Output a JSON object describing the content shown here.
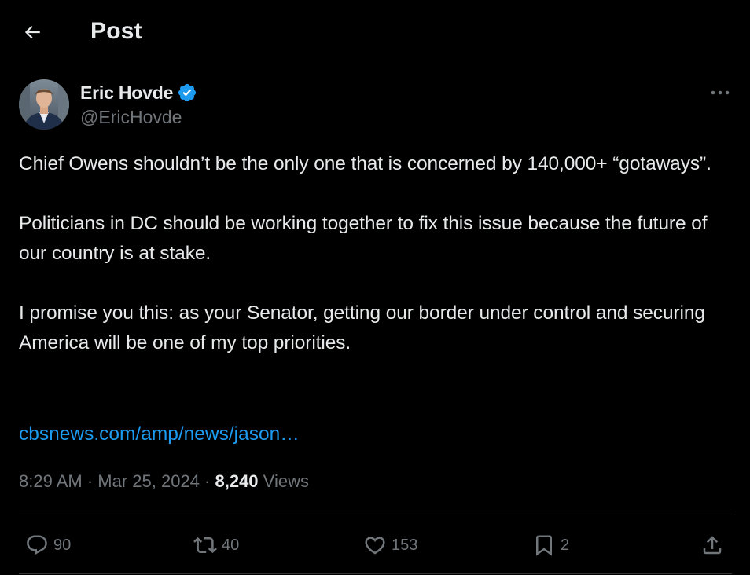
{
  "header": {
    "title": "Post",
    "back_icon": "arrow-left-icon"
  },
  "author": {
    "display_name": "Eric Hovde",
    "handle": "@EricHovde",
    "verified": true,
    "verified_icon": "verified-badge-icon",
    "avatar_icon": "avatar-photo"
  },
  "post": {
    "paragraphs": [
      "Chief Owens shouldn’t be the only one that is concerned by 140,000+ “gotaways”.",
      "Politicians in DC should be working together to fix this issue because the future of our country is at stake.",
      "I promise you this: as your Senator, getting our border under control and securing America will be one of my top priorities."
    ],
    "link_text": "cbsnews.com/amp/news/jason…",
    "time": "8:29 AM",
    "sep1": " · ",
    "date": "Mar 25, 2024",
    "sep2": " · ",
    "views_count": "8,240",
    "views_label": "Views"
  },
  "actions": {
    "reply": {
      "icon": "reply-icon",
      "count": "90"
    },
    "repost": {
      "icon": "repost-icon",
      "count": "40"
    },
    "like": {
      "icon": "heart-icon",
      "count": "153"
    },
    "bookmark": {
      "icon": "bookmark-icon",
      "count": "2"
    },
    "share": {
      "icon": "share-icon"
    }
  },
  "colors": {
    "background": "#000000",
    "text_primary": "#e7e9ea",
    "text_secondary": "#71767b",
    "link": "#1d9bf0",
    "verified": "#1d9bf0",
    "divider": "#2f3336"
  }
}
